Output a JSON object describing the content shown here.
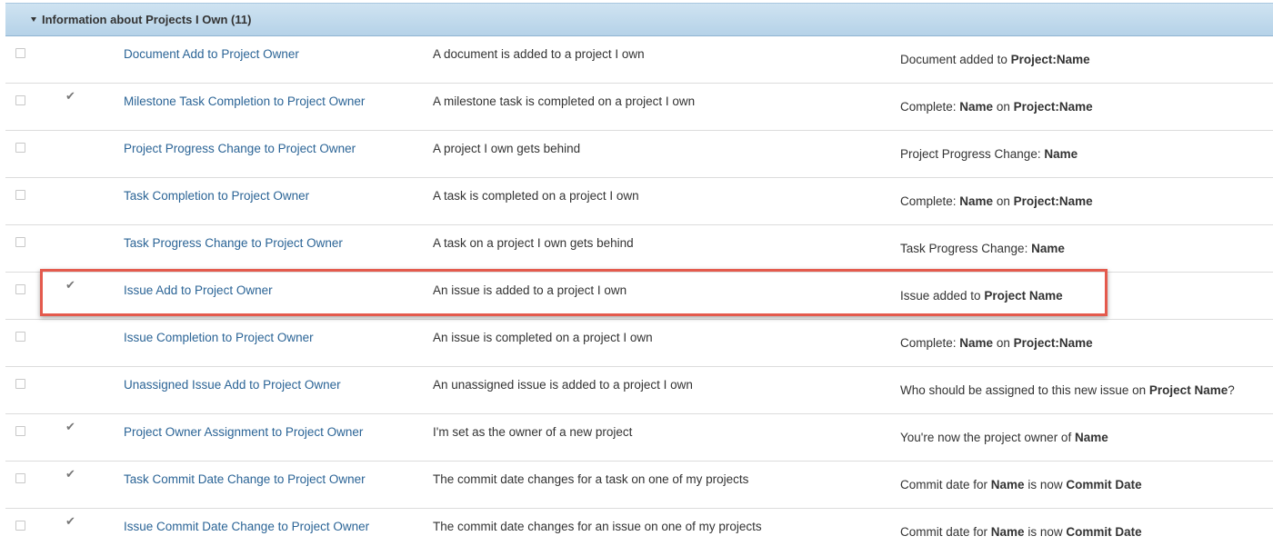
{
  "section": {
    "title": "Information about Projects I Own (11)"
  },
  "rows": [
    {
      "checked": false,
      "name": "Document Add to Project Owner",
      "description": "A document is added to a project I own",
      "subject": [
        {
          "text": "Document added to ",
          "bold": false
        },
        {
          "text": "Project:Name",
          "bold": true
        }
      ]
    },
    {
      "checked": true,
      "name": "Milestone Task Completion to Project Owner",
      "description": "A milestone task is completed on a project I own",
      "subject": [
        {
          "text": "Complete: ",
          "bold": false
        },
        {
          "text": "Name",
          "bold": true
        },
        {
          "text": " on ",
          "bold": false
        },
        {
          "text": "Project:Name",
          "bold": true
        }
      ]
    },
    {
      "checked": false,
      "name": "Project Progress Change to Project Owner",
      "description": "A project I own gets behind",
      "subject": [
        {
          "text": "Project Progress Change: ",
          "bold": false
        },
        {
          "text": "Name",
          "bold": true
        }
      ]
    },
    {
      "checked": false,
      "name": "Task Completion to Project Owner",
      "description": "A task is completed on a project I own",
      "subject": [
        {
          "text": "Complete: ",
          "bold": false
        },
        {
          "text": "Name",
          "bold": true
        },
        {
          "text": " on ",
          "bold": false
        },
        {
          "text": "Project:Name",
          "bold": true
        }
      ]
    },
    {
      "checked": false,
      "name": "Task Progress Change to Project Owner",
      "description": "A task on a project I own gets behind",
      "subject": [
        {
          "text": "Task Progress Change: ",
          "bold": false
        },
        {
          "text": "Name",
          "bold": true
        }
      ]
    },
    {
      "checked": true,
      "name": "Issue Add to Project Owner",
      "description": "An issue is added to a project I own",
      "subject": [
        {
          "text": "Issue added to ",
          "bold": false
        },
        {
          "text": "Project Name",
          "bold": true
        }
      ]
    },
    {
      "checked": false,
      "name": "Issue Completion to Project Owner",
      "description": "An issue is completed on a project I own",
      "subject": [
        {
          "text": "Complete: ",
          "bold": false
        },
        {
          "text": "Name",
          "bold": true
        },
        {
          "text": " on ",
          "bold": false
        },
        {
          "text": "Project:Name",
          "bold": true
        }
      ]
    },
    {
      "checked": false,
      "name": "Unassigned Issue Add to Project Owner",
      "description": "An unassigned issue is added to a project I own",
      "subject": [
        {
          "text": "Who should be assigned to this new issue on ",
          "bold": false
        },
        {
          "text": "Project Name",
          "bold": true
        },
        {
          "text": "?",
          "bold": false
        }
      ]
    },
    {
      "checked": true,
      "name": "Project Owner Assignment to Project Owner",
      "description": "I'm set as the owner of a new project",
      "subject": [
        {
          "text": "You're now the project owner of ",
          "bold": false
        },
        {
          "text": "Name",
          "bold": true
        }
      ]
    },
    {
      "checked": true,
      "name": "Task Commit Date Change to Project Owner",
      "description": "The commit date changes for a task on one of my projects",
      "subject": [
        {
          "text": "Commit date for ",
          "bold": false
        },
        {
          "text": "Name",
          "bold": true
        },
        {
          "text": " is now ",
          "bold": false
        },
        {
          "text": "Commit Date",
          "bold": true
        }
      ]
    },
    {
      "checked": true,
      "name": "Issue Commit Date Change to Project Owner",
      "description": "The commit date changes for an issue on one of my projects",
      "subject": [
        {
          "text": "Commit date for ",
          "bold": false
        },
        {
          "text": "Name",
          "bold": true
        },
        {
          "text": " is now ",
          "bold": false
        },
        {
          "text": "Commit Date",
          "bold": true
        }
      ]
    }
  ],
  "check_glyph": "✔",
  "highlight_color": "#e45a4d",
  "link_color": "#2b6496"
}
